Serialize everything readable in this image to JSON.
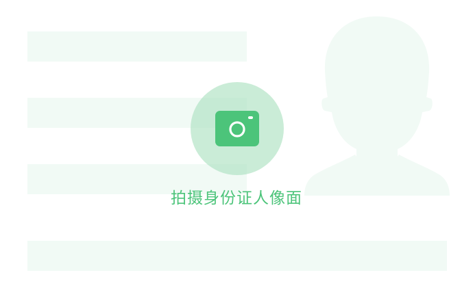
{
  "capture": {
    "label": "拍摄身份证人像面",
    "icon": "camera-icon"
  },
  "colors": {
    "accent": "#4cc47a",
    "circle": "#c6ecd4",
    "placeholder": "#f1faf5"
  }
}
